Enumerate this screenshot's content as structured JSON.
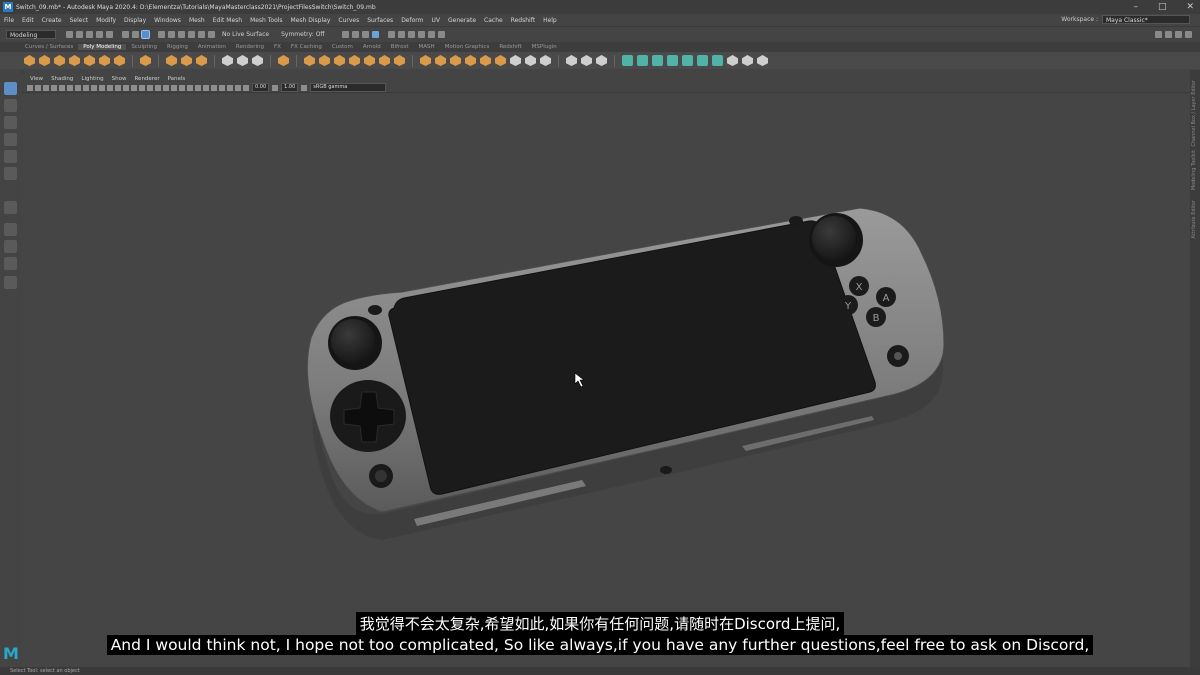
{
  "window": {
    "title": "Switch_09.mb* - Autodesk Maya 2020.4: D:\\Elementza\\Tutorials\\MayaMasterclass2021\\ProjectFilesSwitch\\Switch_09.mb",
    "min": "–",
    "max": "□",
    "close": "✕"
  },
  "menu": [
    "File",
    "Edit",
    "Create",
    "Select",
    "Modify",
    "Display",
    "Windows",
    "Mesh",
    "Edit Mesh",
    "Mesh Tools",
    "Mesh Display",
    "Curves",
    "Surfaces",
    "Deform",
    "UV",
    "Generate",
    "Cache",
    "Redshift",
    "Help"
  ],
  "workspace": {
    "label": "Workspace :",
    "value": "Maya Classic*"
  },
  "status": {
    "mode": "Modeling",
    "live_surface": "No Live Surface",
    "symmetry": "Symmetry: Off"
  },
  "shelf_tabs": [
    "Curves / Surfaces",
    "Poly Modeling",
    "Sculpting",
    "Rigging",
    "Animation",
    "Rendering",
    "FX",
    "FX Caching",
    "Custom",
    "Arnold",
    "Bifrost",
    "MASH",
    "Motion Graphics",
    "Redshift",
    "MSPlugin"
  ],
  "shelf_active": "Poly Modeling",
  "panel_menu": [
    "View",
    "Shading",
    "Lighting",
    "Show",
    "Renderer",
    "Panels"
  ],
  "panel_fields": {
    "f1": "0.00",
    "f2": "1.00",
    "colorspace": "sRGB gamma"
  },
  "right_tabs": [
    "Channel Box / Layer Editor",
    "Modeling Toolkit",
    "Attribute Editor"
  ],
  "console": {
    "left": "A",
    "right": "B",
    "top": "X",
    "bottom": "Y"
  },
  "subtitles": {
    "cn": "我觉得不会太复杂,希望如此,如果你有任何问题,请随时在Discord上提问,",
    "en": "And I would think not, I hope not too complicated, So like always,if you have any further questions,feel free to ask on Discord,"
  },
  "help_line": "Select Tool: select an object",
  "logo": "M"
}
